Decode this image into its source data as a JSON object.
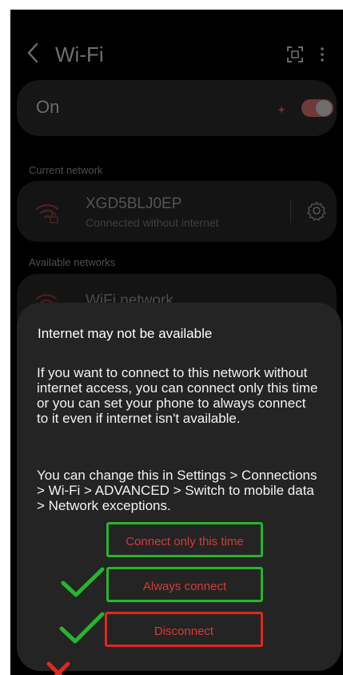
{
  "header": {
    "title": "Wi-Fi"
  },
  "wifi_toggle": {
    "label": "On",
    "state": "on"
  },
  "current_network": {
    "section_label": "Current network",
    "ssid": "XGD5BLJ0EP",
    "status": "Connected without internet"
  },
  "available_networks": {
    "section_label": "Available networks",
    "items": [
      {
        "name": "WiFi network"
      }
    ]
  },
  "dialog": {
    "title": "Internet may not be available",
    "body1": "If you want to connect to this network without internet access, you can connect only this time or you can set your phone to always connect to it even if internet isn't available.",
    "body2": "You can change this in Settings > Connections > Wi-Fi > ADVANCED > Switch to mobile data > Network exceptions.",
    "actions": [
      {
        "label": "Connect only this time",
        "annotation": "green-box"
      },
      {
        "label": "Always connect",
        "annotation": "green-box"
      },
      {
        "label": "Disconnect",
        "annotation": "red-box"
      }
    ]
  },
  "colors": {
    "dialog_bg": "#242424",
    "action_text": "#d43a3a",
    "annotation_green": "#27b52d",
    "annotation_red": "#e0281f"
  }
}
